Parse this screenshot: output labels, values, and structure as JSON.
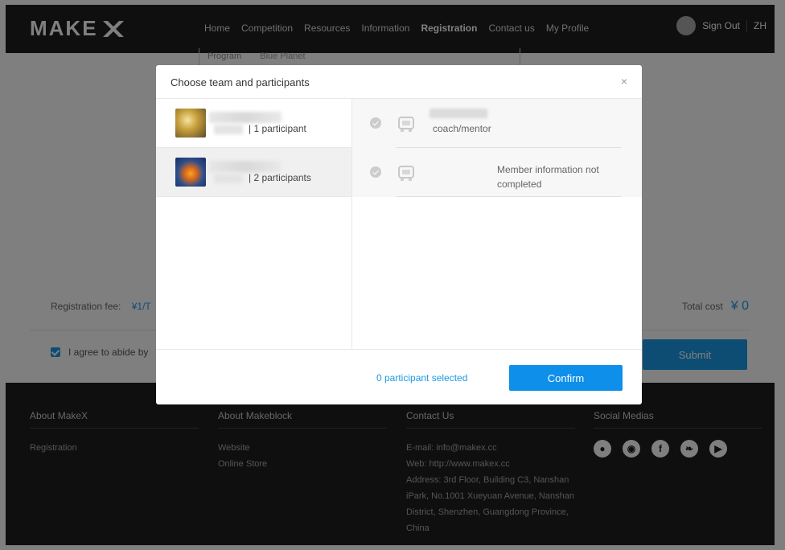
{
  "nav": {
    "logo": "MAKE",
    "items": [
      "Home",
      "Competition",
      "Resources",
      "Information",
      "Registration",
      "Contact us",
      "My Profile"
    ],
    "active": "Registration",
    "sign_out": "Sign Out",
    "lang": "ZH"
  },
  "form": {
    "program_label": "Program",
    "program_value": "Blue Planet",
    "fee_label": "Registration fee:",
    "fee_value": "¥1/T",
    "total_label": "Total cost",
    "total_value": "¥ 0",
    "agree_text": "I agree to abide by",
    "submit_label": "Submit"
  },
  "modal": {
    "title": "Choose team and participants",
    "close": "×",
    "teams": [
      {
        "count": "| 1 participant",
        "selected": false
      },
      {
        "count": "| 2 participants",
        "selected": true
      }
    ],
    "members": [
      {
        "role": "coach/mentor",
        "note": ""
      },
      {
        "role": "",
        "note": "Member information not completed"
      }
    ],
    "selected_count": "0 participant selected",
    "confirm_label": "Confirm"
  },
  "footer": {
    "about_makex": {
      "title": "About MakeX",
      "links": [
        "Registration"
      ]
    },
    "about_makeblock": {
      "title": "About Makeblock",
      "links": [
        "Website",
        "Online Store"
      ]
    },
    "contact": {
      "title": "Contact Us",
      "email": "E-mail: info@makex.cc",
      "web": "Web: http://www.makex.cc",
      "address": "Address: 3rd Floor, Building C3, Nanshan iPark, No.1001 Xueyuan Avenue, Nanshan District, Shenzhen, Guangdong Province, China"
    },
    "social": {
      "title": "Social Medias",
      "icons": [
        "wechat-icon",
        "weibo-icon",
        "facebook-icon",
        "twitter-icon",
        "youtube-icon"
      ]
    }
  },
  "colors": {
    "accent": "#1a9be6",
    "dark": "#1f1f1f"
  }
}
